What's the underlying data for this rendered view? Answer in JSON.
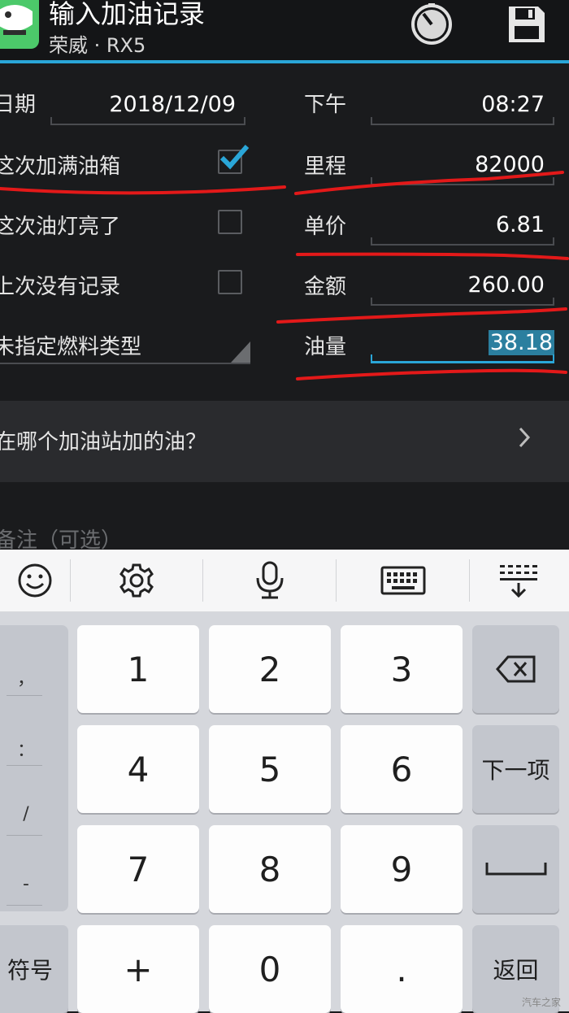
{
  "app": {
    "title": "输入加油记录",
    "subtitle": "荣威 · RX5"
  },
  "form": {
    "date_label": "日期",
    "date_value": "2018/12/09",
    "time_label": "下午",
    "time_value": "08:27",
    "full_tank_label": "这次加满油箱",
    "full_tank_checked": true,
    "light_on_label": "这次油灯亮了",
    "light_on_checked": false,
    "no_last_record_label": "上次没有记录",
    "no_last_record_checked": false,
    "fuel_type_label": "未指定燃料类型",
    "mileage_label": "里程",
    "mileage_value": "82000",
    "price_label": "单价",
    "price_value": "6.81",
    "amount_label": "金额",
    "amount_value": "260.00",
    "volume_label": "油量",
    "volume_value": "38.18",
    "station_label": "在哪个加油站加的油？",
    "notes_placeholder": "备注（可选）"
  },
  "colors": {
    "accent": "#2aa6d8",
    "annotation": "#e31919"
  },
  "keyboard": {
    "symbols": [
      "，",
      "：",
      "/",
      "-"
    ],
    "keys": {
      "k1": "1",
      "k2": "2",
      "k3": "3",
      "k4": "4",
      "k5": "5",
      "k6": "6",
      "k7": "7",
      "k8": "8",
      "k9": "9",
      "plus": "+",
      "k0": "0",
      "dot": ".",
      "next": "下一项",
      "symbols_key": "符号",
      "back": "返回"
    },
    "toolbar_icons": [
      "emoji-icon",
      "settings-icon",
      "mic-icon",
      "keyboard-icon",
      "hide-keyboard-icon"
    ]
  },
  "watermark": "汽车之家"
}
